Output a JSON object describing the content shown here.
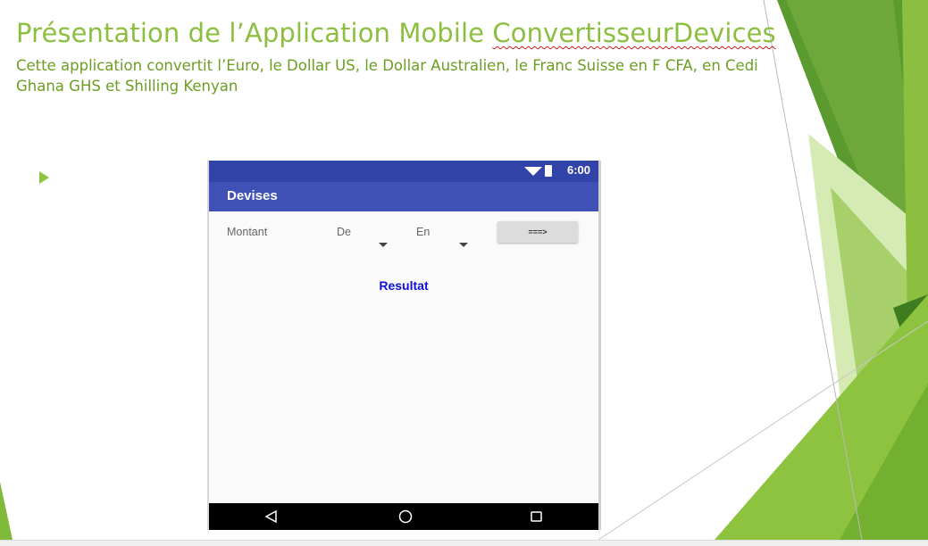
{
  "slide": {
    "title_prefix": "Présentation de l’Application Mobile ",
    "title_app_name": "ConvertisseurDevices",
    "subtitle": "Cette application convertit l’Euro, le Dollar US, le Dollar Australien, le Franc Suisse  en F CFA, en Cedi Ghana GHS et Shilling Kenyan",
    "bullet_icon": "triangle-bullet-icon",
    "colors": {
      "title": "#8cbf3f",
      "subtitle": "#6b9e23",
      "accent_dark": "#4f8a2a",
      "accent_light": "#c8e39b"
    }
  },
  "phone": {
    "status_bar": {
      "time": "6:00",
      "icons": [
        "wifi-icon",
        "battery-icon"
      ],
      "color": "#3243a8"
    },
    "app_bar": {
      "title": "Devises",
      "color": "#3f51b5"
    },
    "form": {
      "amount_label": "Montant",
      "from_label": "De",
      "to_label": "En",
      "convert_button": "===>",
      "result": "Resultat",
      "result_color": "#1010d8"
    },
    "nav_bar": {
      "icons": [
        "back-triangle-icon",
        "home-circle-icon",
        "recents-square-icon"
      ]
    }
  }
}
